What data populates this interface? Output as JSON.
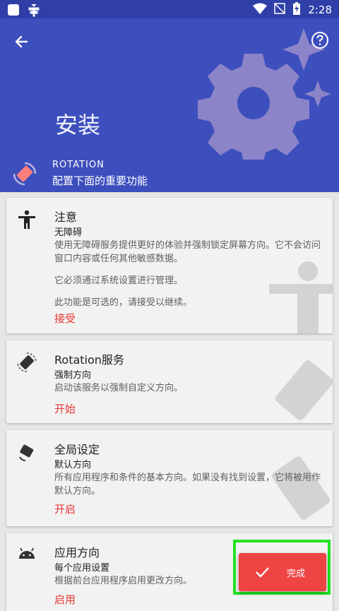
{
  "status_bar": {
    "time": "2:28",
    "left_icons": [
      "square-icon",
      "bug-icon"
    ],
    "right_icons": [
      "wifi-icon",
      "no-signal-icon",
      "battery-charging-icon"
    ]
  },
  "header": {
    "title": "安装",
    "app_name": "ROTATION",
    "app_description": "配置下面的重要功能"
  },
  "cards": [
    {
      "title": "注意",
      "subtitle": "无障碍",
      "body": [
        "使用无障碍服务提供更好的体验并强制锁定屏幕方向。它不会访问窗口内容或任何其他敏感数据。",
        "它必须通过系统设置进行管理。",
        "此功能是可选的，请接受以继续。"
      ],
      "action": "接受",
      "icon": "accessibility-icon"
    },
    {
      "title": "Rotation服务",
      "subtitle": "强制方向",
      "body": [
        "启动该服务以强制自定义方向。"
      ],
      "action": "开始",
      "icon": "rotation-service-icon"
    },
    {
      "title": "全局设定",
      "subtitle": "默认方向",
      "body": [
        "所有应用程序和条件的基本方向。如果没有找到设置，它将被用作默认方向。"
      ],
      "action": "开启",
      "icon": "phone-rotate-icon"
    },
    {
      "title": "应用方向",
      "subtitle": "每个应用设置",
      "body": [
        "根据前台应用程序启用更改方向。"
      ],
      "action": "启用",
      "icon": "android-icon"
    }
  ],
  "fab": {
    "label": "完成",
    "icon": "check-icon"
  },
  "colors": {
    "primary": "#3d4fbd",
    "status_bar": "#2f3fa7",
    "accent": "#ef4444",
    "highlight": "#22e322"
  }
}
